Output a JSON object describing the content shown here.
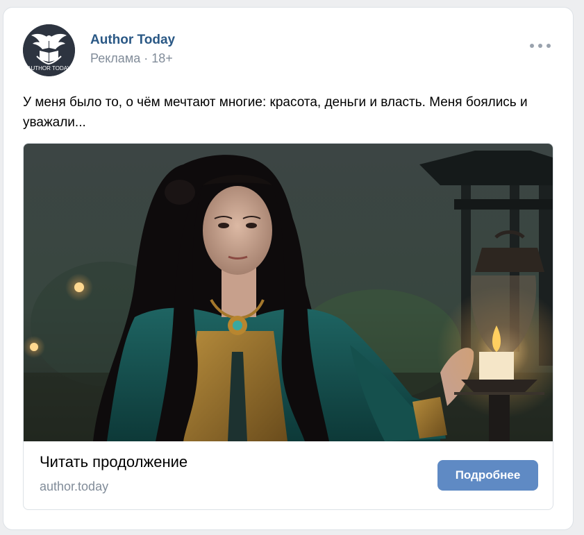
{
  "post": {
    "author": {
      "name": "Author Today",
      "avatar_text": "AUTHOR TODAY"
    },
    "meta": "Реклама · 18+",
    "text": "У меня было то, о чём мечтают многие: красота, деньги и власть. Меня боялись и уважали..."
  },
  "attachment": {
    "image_alt": "woman-with-lantern-illustration",
    "link_title": "Читать продолжение",
    "link_domain": "author.today",
    "cta_label": "Подробнее"
  },
  "colors": {
    "author_link": "#2a5885",
    "cta_background": "#5f8ac4",
    "muted_text": "#818c99"
  },
  "icons": {
    "more": "more-horizontal-icon",
    "avatar_logo": "eagle-book-logo-icon"
  }
}
